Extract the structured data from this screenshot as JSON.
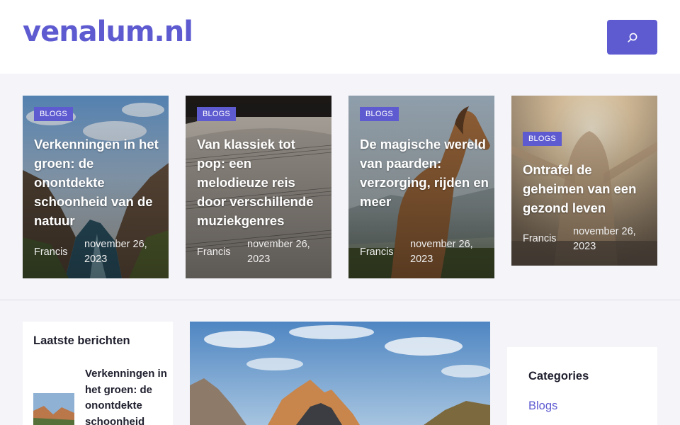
{
  "site": {
    "logo": "venalum.nl",
    "accent": "#5e5bd1"
  },
  "header": {
    "search_icon": "search-icon"
  },
  "featured": [
    {
      "badge": "BLOGS",
      "title": "Verkenningen in het groen: de onontdekte schoonheid van de natuur",
      "author": "Francis",
      "date": "november 26, 2023",
      "image": "canyon-river-photo"
    },
    {
      "badge": "BLOGS",
      "title": "Van klassiek tot pop: een melodieuze reis door verschillende muziekgenres",
      "author": "Francis",
      "date": "november 26, 2023",
      "image": "sheet-music-photo"
    },
    {
      "badge": "BLOGS",
      "title": "De magische wereld van paarden: verzorging, rijden en meer",
      "author": "Francis",
      "date": "november 26, 2023",
      "image": "horse-photo"
    },
    {
      "badge": "BLOGS",
      "title": "Ontrafel de geheimen van een gezond leven",
      "author": "Francis",
      "date": "november 26, 2023",
      "image": "woman-sunset-photo"
    }
  ],
  "sidebar_left": {
    "title": "Laatste berichten",
    "post_title": "Verkenningen in het groen: de onontdekte schoonheid"
  },
  "sidebar_right": {
    "title": "Categories",
    "link": "Blogs"
  }
}
